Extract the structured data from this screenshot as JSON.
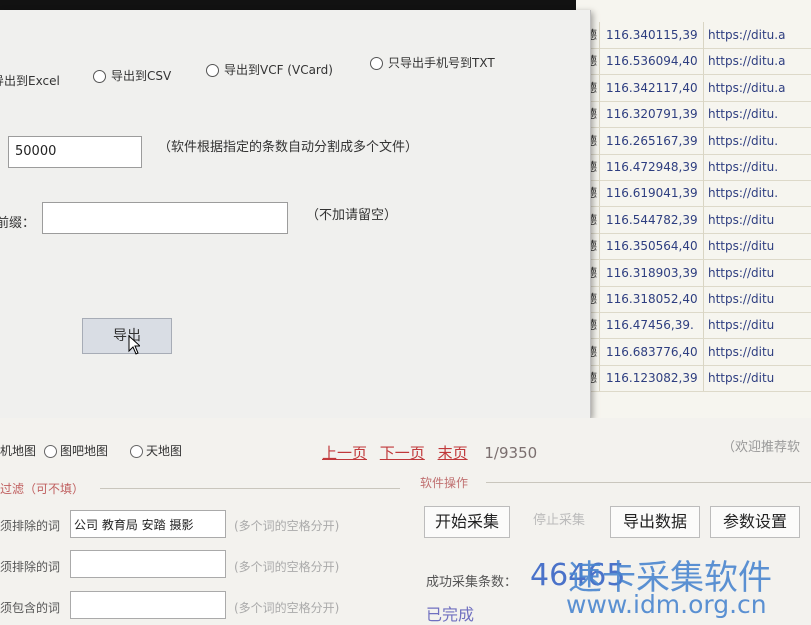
{
  "export_dialog": {
    "radio_excel": "导出到Excel",
    "radio_csv": "导出到CSV",
    "radio_vcf": "导出到VCF (VCard)",
    "radio_txt": "只导出手机号到TXT",
    "split_value": "50000",
    "split_hint": "（软件根据指定的条数自动分割成多个文件）",
    "prefix_label": "前缀：",
    "prefix_value": "",
    "prefix_hint": "（不加请留空）",
    "export_button": "导出"
  },
  "data_table": {
    "rows": [
      {
        "name": "德",
        "coord": "116.340115,39",
        "url": "https://ditu.a"
      },
      {
        "name": "德",
        "coord": "116.536094,40",
        "url": "https://ditu.a"
      },
      {
        "name": "德",
        "coord": "116.342117,40",
        "url": "https://ditu.a"
      },
      {
        "name": "德",
        "coord": "116.320791,39",
        "url": "https://ditu."
      },
      {
        "name": "德",
        "coord": "116.265167,39",
        "url": "https://ditu."
      },
      {
        "name": "德",
        "coord": "116.472948,39",
        "url": "https://ditu."
      },
      {
        "name": "德",
        "coord": "116.619041,39",
        "url": "https://ditu."
      },
      {
        "name": "德",
        "coord": "116.544782,39",
        "url": "https://ditu"
      },
      {
        "name": "德",
        "coord": "116.350564,40",
        "url": "https://ditu"
      },
      {
        "name": "德",
        "coord": "116.318903,39",
        "url": "https://ditu"
      },
      {
        "name": "德",
        "coord": "116.318052,40",
        "url": "https://ditu"
      },
      {
        "name": "德",
        "coord": "116.47456,39.",
        "url": "https://ditu"
      },
      {
        "name": "德",
        "coord": "116.683776,40",
        "url": "https://ditu"
      },
      {
        "name": "德",
        "coord": "116.123082,39",
        "url": "https://ditu"
      }
    ]
  },
  "main_panel": {
    "map_options": [
      "机地图",
      "图吧地图",
      "天地图"
    ],
    "pager": {
      "prev": "上一页",
      "next": "下一页",
      "last": "末页",
      "count": "1/9350"
    },
    "welcome": "（欢迎推荐软",
    "filter_title": "过滤（可不填）",
    "filters": [
      {
        "label": "须排除的词",
        "value": "公司 教育局 安踏 摄影",
        "hint": "(多个词的空格分开)"
      },
      {
        "label": "须排除的词",
        "value": "",
        "hint": "(多个词的空格分开)"
      },
      {
        "label": "须包含的词",
        "value": "",
        "hint": "(多个词的空格分开)"
      }
    ],
    "ops_title": "软件操作",
    "buttons": {
      "start": "开始采集",
      "stop": "停止采集",
      "export": "导出数据",
      "settings": "参数设置"
    },
    "success_label": "成功采集条数：",
    "success_count": "46465",
    "status": "已完成"
  },
  "watermark": {
    "line1": "速卡采集软件",
    "line2": "www.idm.org.cn"
  }
}
